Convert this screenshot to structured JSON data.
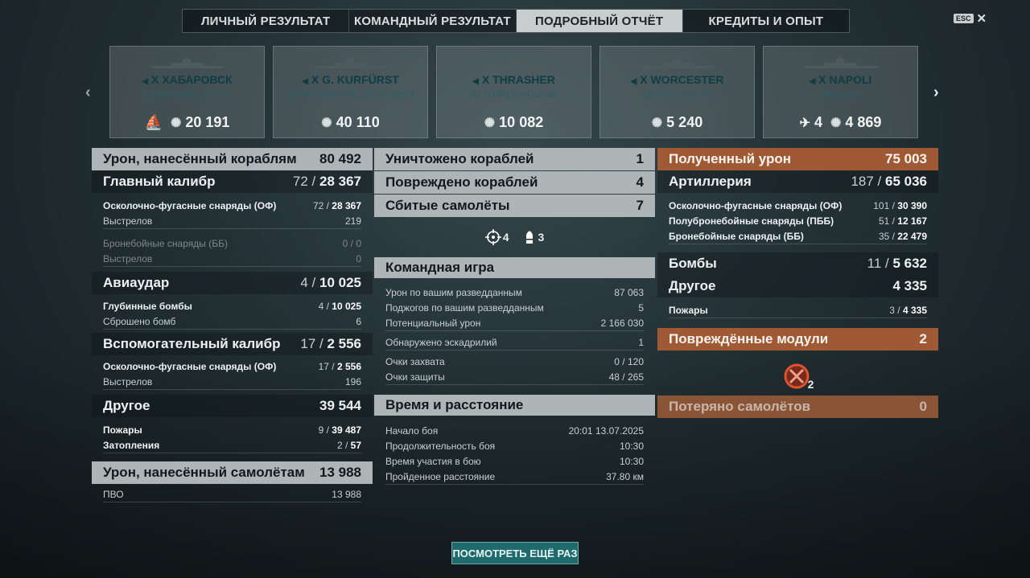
{
  "tabs": [
    "ЛИЧНЫЙ РЕЗУЛЬТАТ",
    "КОМАНДНЫЙ РЕЗУЛЬТАТ",
    "ПОДРОБНЫЙ ОТЧЁТ",
    "КРЕДИТЫ И ОПЫТ"
  ],
  "esc_label": "ESC",
  "ships": [
    {
      "tier": "X",
      "name": "ХАБАРОВСК",
      "player": "[1RANG]Alex_KTOF",
      "extra": "",
      "damage": "20 191"
    },
    {
      "tier": "X",
      "name": "G. KURFÜRST",
      "player": "[UNIKA]berkut80_2024_geroj",
      "extra": "",
      "damage": "40 110"
    },
    {
      "tier": "X",
      "name": "THRASHER",
      "player": "[SUVOR]StarCurtain",
      "extra": "",
      "damage": "10 082"
    },
    {
      "tier": "X",
      "name": "WORCESTER",
      "player": "[2CAP]Tupac76",
      "extra": "",
      "damage": "5 240"
    },
    {
      "tier": "X",
      "name": "NAPOLI",
      "player": "almirsan",
      "extra": "4",
      "damage": "4 869"
    }
  ],
  "left": {
    "damage_header": {
      "label": "Урон, нанесённый кораблям",
      "value": "80 492"
    },
    "main": {
      "label": "Главный калибр",
      "a": "72 /",
      "b": "28 367"
    },
    "main_he": {
      "label": "Осколочно-фугасные снаряды (ОФ)",
      "a": "72 /",
      "b": "28 367"
    },
    "main_he_shots": {
      "label": "Выстрелов",
      "value": "219"
    },
    "main_ap": {
      "label": "Бронебойные снаряды (ББ)",
      "a": "0 /",
      "b": "0"
    },
    "main_ap_shots": {
      "label": "Выстрелов",
      "value": "0"
    },
    "air": {
      "label": "Авиаудар",
      "a": "4 /",
      "b": "10 025"
    },
    "air_depth": {
      "label": "Глубинные бомбы",
      "a": "4 /",
      "b": "10 025"
    },
    "air_dropped": {
      "label": "Сброшено бомб",
      "value": "6"
    },
    "sec": {
      "label": "Вспомогательный калибр",
      "a": "17 /",
      "b": "2 556"
    },
    "sec_he": {
      "label": "Осколочно-фугасные снаряды (ОФ)",
      "a": "17 /",
      "b": "2 556"
    },
    "sec_shots": {
      "label": "Выстрелов",
      "value": "196"
    },
    "other": {
      "label": "Другое",
      "value": "39 544"
    },
    "fires": {
      "label": "Пожары",
      "a": "9 /",
      "b": "39 487"
    },
    "floods": {
      "label": "Затопления",
      "a": "2 /",
      "b": "57"
    },
    "planes_header": {
      "label": "Урон, нанесённый самолётам",
      "value": "13 988"
    },
    "aa": {
      "label": "ПВО",
      "value": "13 988"
    }
  },
  "middle": {
    "destroyed": {
      "label": "Уничтожено кораблей",
      "value": "1"
    },
    "damaged": {
      "label": "Повреждено кораблей",
      "value": "4"
    },
    "planes": {
      "label": "Сбитые самолёты",
      "value": "7"
    },
    "icon_a": "4",
    "icon_b": "3",
    "team_header": "Командная игра",
    "team_rows": [
      {
        "label": "Урон по вашим разведданным",
        "value": "87 063"
      },
      {
        "label": "Поджогов по вашим разведданным",
        "value": "5"
      },
      {
        "label": "Потенциальный урон",
        "value": "2 166 030"
      },
      {
        "label": "Обнаружено эскадрилий",
        "value": "1"
      },
      {
        "label": "Очки захвата",
        "value": "0 / 120"
      },
      {
        "label": "Очки защиты",
        "value": "48 / 265"
      }
    ],
    "time_header": "Время и расстояние",
    "time_rows": [
      {
        "label": "Начало боя",
        "value": "20:01   13.07.2025"
      },
      {
        "label": "Продолжительность боя",
        "value": "10:30"
      },
      {
        "label": "Время участия в бою",
        "value": "10:30"
      },
      {
        "label": "Пройденное расстояние",
        "value": "37.80 км"
      }
    ]
  },
  "right": {
    "received": {
      "label": "Полученный урон",
      "value": "75 003"
    },
    "art": {
      "label": "Артиллерия",
      "a": "187 /",
      "b": "65 036"
    },
    "art_he": {
      "label": "Осколочно-фугасные снаряды (ОФ)",
      "a": "101 /",
      "b": "30 390"
    },
    "art_sap": {
      "label": "Полубронебойные снаряды (ПББ)",
      "a": "51 /",
      "b": "12 167"
    },
    "art_ap": {
      "label": "Бронебойные снаряды (ББ)",
      "a": "35 /",
      "b": "22 479"
    },
    "bombs": {
      "label": "Бомбы",
      "a": "11 /",
      "b": "5 632"
    },
    "other": {
      "label": "Другое",
      "value": "4 335"
    },
    "fires": {
      "label": "Пожары",
      "a": "3 /",
      "b": "4 335"
    },
    "modules": {
      "label": "Повреждённые модули",
      "value": "2"
    },
    "module_count": "2",
    "lost_planes": {
      "label": "Потеряно самолётов",
      "value": "0"
    }
  },
  "replay_button": "ПОСМОТРЕТЬ ЕЩЁ РАЗ",
  "colors": {
    "accent_orange": "#9f5a35",
    "teal_button": "#1f6a6c",
    "light_header": "#aeb5b6"
  }
}
